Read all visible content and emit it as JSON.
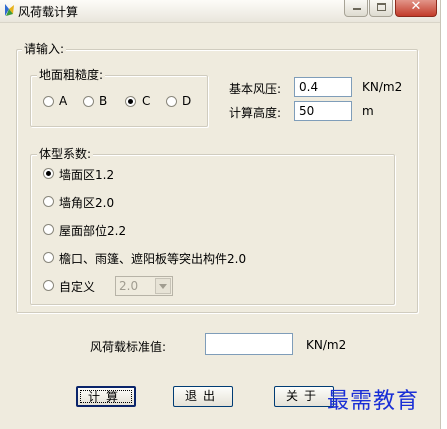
{
  "window": {
    "title": "风荷载计算"
  },
  "input_group": {
    "label": "请输入:"
  },
  "roughness": {
    "label": "地面粗糙度:",
    "options": [
      "A",
      "B",
      "C",
      "D"
    ],
    "selected": "C"
  },
  "wind_pressure": {
    "label": "基本风压:",
    "value": "0.4",
    "unit": "KN/m2"
  },
  "height": {
    "label": "计算高度:",
    "value": "50",
    "unit": "m"
  },
  "shape_factor": {
    "label": "体型系数:",
    "options": [
      "墙面区1.2",
      "墙角区2.0",
      "屋面部位2.2",
      "檐口、雨篷、遮阳板等突出构件2.0",
      "自定义"
    ],
    "selected": 0,
    "custom_value": "2.0"
  },
  "result": {
    "label": "风荷载标准值:",
    "value": "",
    "unit": "KN/m2"
  },
  "buttons": {
    "calc": "计算",
    "exit": "退出",
    "about": "关于"
  },
  "watermark": "最需教育",
  "colors": {
    "title_close": "#c23b2a",
    "input_border": "#7f9db9",
    "watermark": "#1a2fd6"
  }
}
